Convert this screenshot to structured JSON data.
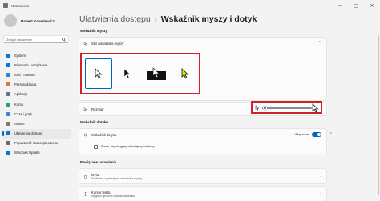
{
  "window": {
    "title": "Ustawienia",
    "controls": [
      "–",
      "▢",
      "✕"
    ]
  },
  "profile": {
    "name": "Robert Kowalewicz"
  },
  "search": {
    "placeholder": "Znajdź ustawienie"
  },
  "sidebar": {
    "items": [
      {
        "label": "System",
        "icon": "system-icon",
        "color": "#0078d4"
      },
      {
        "label": "Bluetooth i urządzenia",
        "icon": "bluetooth-icon",
        "color": "#0078d4"
      },
      {
        "label": "Sieć i Internet",
        "icon": "network-icon",
        "color": "#3a7bd5"
      },
      {
        "label": "Personalizacja",
        "icon": "brush-icon",
        "color": "#d87a2a"
      },
      {
        "label": "Aplikacje",
        "icon": "apps-icon",
        "color": "#6b6b9a"
      },
      {
        "label": "Konta",
        "icon": "account-icon",
        "color": "#2aa06b"
      },
      {
        "label": "Czas i język",
        "icon": "clock-icon",
        "color": "#3a86c8"
      },
      {
        "label": "Granie",
        "icon": "gaming-icon",
        "color": "#7a7a7a"
      },
      {
        "label": "Ułatwienia dostępu",
        "icon": "accessibility-icon",
        "color": "#1a6fbf",
        "active": true
      },
      {
        "label": "Prywatność i zabezpieczenia",
        "icon": "shield-icon",
        "color": "#6b6b6b"
      },
      {
        "label": "Windows Update",
        "icon": "update-icon",
        "color": "#0078d4"
      }
    ]
  },
  "breadcrumb": {
    "parent": "Ułatwienia dostępu",
    "separator": "›",
    "current": "Wskaźnik myszy i dotyk"
  },
  "sections": {
    "mouse_pointer": "Wskaźnik myszy",
    "touch": "Wskaźnik dotyku",
    "related": "Powiązane ustawienia"
  },
  "pointer_style": {
    "label": "Styl wskaźnika myszy",
    "selected_index": 0
  },
  "pointer_size": {
    "label": "Rozmiar",
    "value_fraction": 0.05
  },
  "touch": {
    "label": "Wskaźnik dotyku",
    "state": "Włączone",
    "checkbox_label": "Spraw, aby okrąg był ciemniejszy i większy"
  },
  "related": {
    "items": [
      {
        "label": "Mysz",
        "sub": "Szybkość i przewijanie wskaźnika myszy"
      },
      {
        "label": "Kursor tekstu",
        "sub": "Wygląd i grubość wskaźnika tekstu"
      }
    ]
  },
  "colors": {
    "accent": "#0067c0",
    "highlight_border": "#d0202a"
  }
}
